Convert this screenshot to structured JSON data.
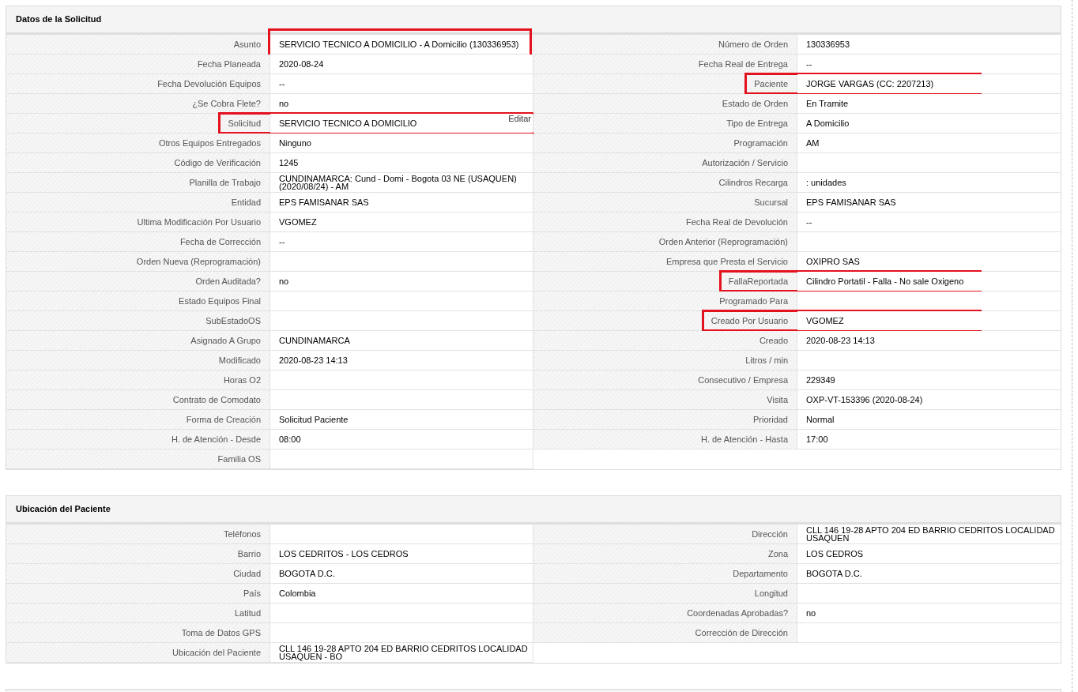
{
  "sections": [
    {
      "title": "Datos de la Solicitud",
      "columns": [
        [
          {
            "label": "Asunto",
            "value": "SERVICIO TECNICO A DOMICILIO - A Domicilio (130336953)",
            "label_marked": false,
            "value_marked": true
          },
          {
            "label": "Fecha Planeada",
            "value": "2020-08-24",
            "label_marked": false,
            "value_marked": false
          },
          {
            "label": "Fecha Devolución Equipos",
            "value": "--",
            "label_marked": false,
            "value_marked": false
          },
          {
            "label": "¿Se Cobra Flete?",
            "value": "no",
            "label_marked": false,
            "value_marked": false
          },
          {
            "label": "Solicitud",
            "value": "SERVICIO TECNICO A DOMICILIO",
            "action": "Editar",
            "label_marked": true,
            "value_marked": true
          },
          {
            "label": "Otros Equipos Entregados",
            "value": "Ninguno",
            "label_marked": false,
            "value_marked": false
          },
          {
            "label": "Código de Verificación",
            "value": "1245",
            "label_marked": false,
            "value_marked": false
          },
          {
            "label": "Planilla de Trabajo",
            "value": "CUNDINAMARCA: Cund - Domi - Bogota 03 NE (USAQUEN) (2020/08/24) - AM",
            "label_marked": false,
            "value_marked": false
          },
          {
            "label": "Entidad",
            "value": "EPS FAMISANAR SAS",
            "label_marked": false,
            "value_marked": false
          },
          {
            "label": "Ultima Modificación Por Usuario",
            "value": "VGOMEZ",
            "label_marked": false,
            "value_marked": false
          },
          {
            "label": "Fecha de Corrección",
            "value": "--",
            "label_marked": false,
            "value_marked": false
          },
          {
            "label": "Orden Nueva (Reprogramación)",
            "label_marked": false,
            "value_marked": false
          },
          {
            "label": "Orden Auditada?",
            "value": "no",
            "label_marked": false,
            "value_marked": false
          },
          {
            "label": "Estado Equipos Final",
            "label_marked": false,
            "value_marked": false
          },
          {
            "label": "SubEstadoOS",
            "label_marked": false,
            "value_marked": false
          },
          {
            "label": "Asignado A Grupo",
            "value": "CUNDINAMARCA",
            "label_marked": false,
            "value_marked": false
          },
          {
            "label": "Modificado",
            "value": "2020-08-23 14:13",
            "label_marked": false,
            "value_marked": false
          },
          {
            "label": "Horas O2",
            "label_marked": false,
            "value_marked": false
          },
          {
            "label": "Contrato de Comodato",
            "label_marked": false,
            "value_marked": false
          },
          {
            "label": "Forma de Creación",
            "value": "Solicitud Paciente",
            "label_marked": false,
            "value_marked": false
          },
          {
            "label": "H. de Atención - Desde",
            "value": "08:00",
            "label_marked": false,
            "value_marked": false
          },
          {
            "label": "Familia OS",
            "label_marked": false,
            "value_marked": false
          }
        ],
        [
          {
            "label": "Número de Orden",
            "value": "130336953",
            "label_marked": false,
            "value_marked": false
          },
          {
            "label": "Fecha Real de Entrega",
            "value": "--",
            "label_marked": false,
            "value_marked": false
          },
          {
            "label": "Paciente",
            "value": "JORGE VARGAS (CC: 2207213)",
            "label_marked": true,
            "value_marked": true
          },
          {
            "label": "Estado de Orden",
            "value": "En Tramite",
            "label_marked": false,
            "value_marked": false
          },
          {
            "label": "Tipo de Entrega",
            "value": "A Domicilio",
            "label_marked": false,
            "value_marked": false
          },
          {
            "label": "Programación",
            "value": "AM",
            "label_marked": false,
            "value_marked": false
          },
          {
            "label": "Autorización / Servicio",
            "label_marked": false,
            "value_marked": false
          },
          {
            "label": "Cilindros Recarga",
            "value": ": unidades",
            "label_marked": false,
            "value_marked": false
          },
          {
            "label": "Sucursal",
            "value": "EPS FAMISANAR SAS",
            "label_marked": false,
            "value_marked": false
          },
          {
            "label": "Fecha Real de Devolución",
            "value": "--",
            "label_marked": false,
            "value_marked": false
          },
          {
            "label": "Orden Anterior (Reprogramación)",
            "label_marked": false,
            "value_marked": false
          },
          {
            "label": "Empresa que Presta el Servicio",
            "value": "OXIPRO SAS",
            "label_marked": false,
            "value_marked": false
          },
          {
            "label": "FallaReportada",
            "value": "Cilindro Portatil - Falla - No sale Oxigeno",
            "label_marked": true,
            "value_marked": true
          },
          {
            "label": "Programado Para",
            "label_marked": false,
            "value_marked": false
          },
          {
            "label": "Creado Por Usuario",
            "value": "VGOMEZ",
            "label_marked": true,
            "value_marked": true
          },
          {
            "label": "Creado",
            "value": "2020-08-23 14:13",
            "label_marked": false,
            "value_marked": false
          },
          {
            "label": "Litros / min",
            "label_marked": false,
            "value_marked": false
          },
          {
            "label": "Consecutivo / Empresa",
            "value": "229349",
            "label_marked": false,
            "value_marked": false
          },
          {
            "label": "Visita",
            "value": "OXP-VT-153396 (2020-08-24)",
            "label_marked": false,
            "value_marked": false
          },
          {
            "label": "Prioridad",
            "value": "Normal",
            "label_marked": false,
            "value_marked": false
          },
          {
            "label": "H. de Atención - Hasta",
            "value": "17:00",
            "label_marked": false,
            "value_marked": false
          }
        ]
      ]
    },
    {
      "title": "Ubicación del Paciente",
      "columns": [
        [
          {
            "label": "Teléfonos",
            "label_marked": false,
            "value_marked": false
          },
          {
            "label": "Barrio",
            "value": "LOS CEDRITOS - LOS CEDROS",
            "label_marked": false,
            "value_marked": false
          },
          {
            "label": "Ciudad",
            "value": "BOGOTA D.C.",
            "label_marked": false,
            "value_marked": false
          },
          {
            "label": "País",
            "value": "Colombia",
            "label_marked": false,
            "value_marked": false
          },
          {
            "label": "Latitud",
            "label_marked": false,
            "value_marked": false
          },
          {
            "label": "Toma de Datos GPS",
            "label_marked": false,
            "value_marked": false
          },
          {
            "label": "Ubicación del Paciente",
            "value": "CLL 146 19-28 APTO 204 ED BARRIO CEDRITOS LOCALIDAD USAQUEN - BO",
            "label_marked": false,
            "value_marked": false
          }
        ],
        [
          {
            "label": "Dirección",
            "value": "CLL 146 19-28 APTO 204 ED BARRIO CEDRITOS LOCALIDAD USAQUEN",
            "label_marked": false,
            "value_marked": false
          },
          {
            "label": "Zona",
            "value": "LOS CEDROS",
            "label_marked": false,
            "value_marked": false
          },
          {
            "label": "Departamento",
            "value": "BOGOTA D.C.",
            "label_marked": false,
            "value_marked": false
          },
          {
            "label": "Longitud",
            "label_marked": false,
            "value_marked": false
          },
          {
            "label": "Coordenadas Aprobadas?",
            "value": "no",
            "label_marked": false,
            "value_marked": false
          },
          {
            "label": "Corrección de Dirección",
            "label_marked": false,
            "value_marked": false
          }
        ]
      ]
    }
  ]
}
